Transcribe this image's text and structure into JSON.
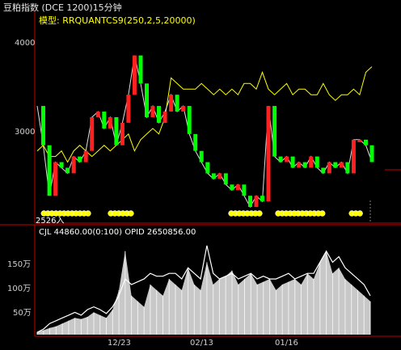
{
  "header": {
    "title": "豆粕指数 (DCE 1200)15分钟",
    "model": "模型: RRQUANTCS9(250,2,5,20000)"
  },
  "price_panel": {
    "yticks": [
      "4000",
      "3000"
    ],
    "low_label": "2526入"
  },
  "volume_panel": {
    "label": "CJL    44860.00(0:100)   OPID 2650856.00",
    "yticks": [
      "150万",
      "100万",
      "50万"
    ]
  },
  "xaxis": {
    "ticks": [
      "12/23",
      "02/13",
      "01/16"
    ]
  },
  "colors": {
    "background": "#000000",
    "axis": "#c00000",
    "up": "#ff2020",
    "down": "#00ff00",
    "model_line": "#ffff00",
    "volume": "#c8c8c8",
    "opid": "#ffffff"
  },
  "chart_data": [
    {
      "type": "line",
      "title": "",
      "ylim": [
        2400,
        4200
      ],
      "series": [
        {
          "values": [
            3400,
            3050,
            2600,
            2900,
            2850,
            2800,
            2950,
            2900,
            3000,
            3300,
            3350,
            3200,
            3300,
            3050,
            3250,
            3500,
            3850,
            3600,
            3300,
            3400,
            3250,
            3350,
            3500,
            3350,
            3400,
            3150,
            3000,
            2900,
            2800,
            2750,
            2800,
            2700,
            2650,
            2700,
            2600,
            2500,
            2600,
            2550,
            3400,
            2950,
            2900,
            2950,
            2850,
            2900,
            2850,
            2950,
            2850,
            2800,
            2900,
            2850,
            2900,
            2800,
            3100,
            3100,
            3050,
            2900
          ]
        },
        {
          "values": [
            3000,
            3050,
            2950,
            2950,
            3000,
            2900,
            3000,
            3050,
            3000,
            2950,
            3000,
            3050,
            3000,
            3050,
            3100,
            3150,
            3000,
            3100,
            3150,
            3200,
            3150,
            3300,
            3650,
            3600,
            3550,
            3550,
            3550,
            3600,
            3550,
            3500,
            3550,
            3500,
            3550,
            3500,
            3600,
            3600,
            3550,
            3700,
            3550,
            3500,
            3550,
            3600,
            3500,
            3550,
            3550,
            3500,
            3500,
            3600,
            3500,
            3450,
            3500,
            3500,
            3550,
            3500,
            3700,
            3750
          ]
        }
      ]
    },
    {
      "type": "area",
      "title": "",
      "ylim": [
        0,
        1800000
      ],
      "series": [
        {
          "values": [
            50000,
            80000,
            120000,
            150000,
            200000,
            250000,
            300000,
            280000,
            320000,
            400000,
            350000,
            300000,
            450000,
            800000,
            1500000,
            700000,
            600000,
            500000,
            900000,
            800000,
            700000,
            1000000,
            900000,
            800000,
            1200000,
            900000,
            800000,
            1300000,
            900000,
            1000000,
            1050000,
            1150000,
            900000,
            1000000,
            1100000,
            900000,
            950000,
            1000000,
            800000,
            900000,
            950000,
            1000000,
            900000,
            1100000,
            1000000,
            1300000,
            1500000,
            1100000,
            1200000,
            1000000,
            900000,
            800000,
            700000,
            600000
          ]
        },
        {
          "values": [
            40000,
            100000,
            200000,
            250000,
            300000,
            350000,
            400000,
            350000,
            450000,
            500000,
            450000,
            380000,
            500000,
            700000,
            1000000,
            900000,
            950000,
            1000000,
            1100000,
            1050000,
            1050000,
            1100000,
            1100000,
            1000000,
            1200000,
            1100000,
            1000000,
            1600000,
            1100000,
            1000000,
            1050000,
            1100000,
            1000000,
            1050000,
            1100000,
            1000000,
            1050000,
            1000000,
            1000000,
            1050000,
            1100000,
            1000000,
            1050000,
            1100000,
            1100000,
            1300000,
            1500000,
            1300000,
            1400000,
            1200000,
            1100000,
            1000000,
            900000,
            700000
          ]
        }
      ]
    }
  ]
}
